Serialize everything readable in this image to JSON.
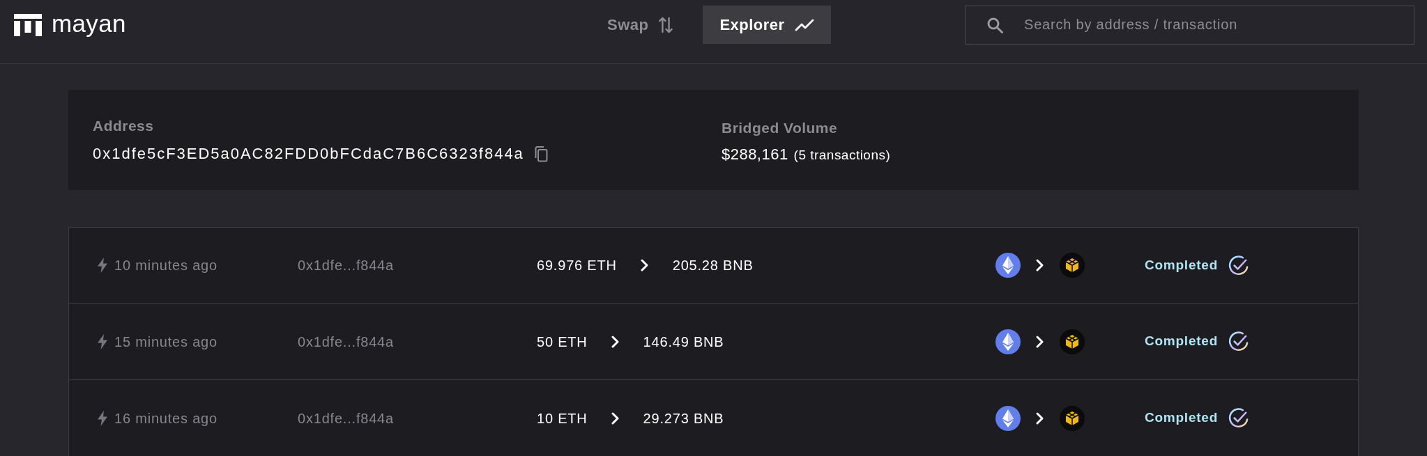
{
  "header": {
    "brand": "mayan",
    "nav": [
      {
        "label": "Swap",
        "selected": false
      },
      {
        "label": "Explorer",
        "selected": true
      }
    ],
    "search": {
      "placeholder": "Search by address / transaction"
    }
  },
  "summary": {
    "address": {
      "label": "Address",
      "value": "0x1dfe5cF3ED5a0AC82FDD0bFCdaC7B6C6323f844a"
    },
    "bridged_volume": {
      "label": "Bridged Volume",
      "value": "$288,161",
      "note": "(5 transactions)"
    }
  },
  "transactions": [
    {
      "time": "10 minutes ago",
      "address": "0x1dfe...f844a",
      "from_amount": "69.976 ETH",
      "to_amount": "205.28 BNB",
      "status": "Completed"
    },
    {
      "time": "15 minutes ago",
      "address": "0x1dfe...f844a",
      "from_amount": "50 ETH",
      "to_amount": "146.49 BNB",
      "status": "Completed"
    },
    {
      "time": "16 minutes ago",
      "address": "0x1dfe...f844a",
      "from_amount": "10 ETH",
      "to_amount": "29.273 BNB",
      "status": "Completed"
    }
  ]
}
